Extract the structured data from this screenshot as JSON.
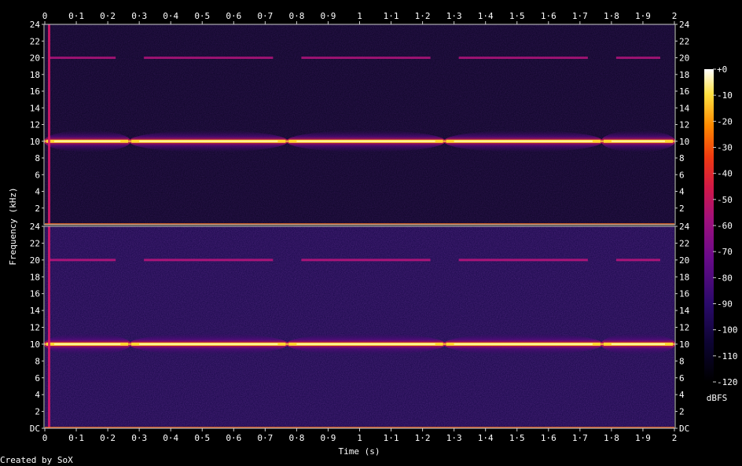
{
  "chart_data": {
    "type": "heatmap",
    "title": "",
    "xlabel": "Time (s)",
    "ylabel": "Frequency (kHz)",
    "xlim": [
      0,
      2
    ],
    "x_ticks": [
      "0",
      "0·1",
      "0·2",
      "0·3",
      "0·4",
      "0·5",
      "0·6",
      "0·7",
      "0·8",
      "0·9",
      "1",
      "1·1",
      "1·2",
      "1·3",
      "1·4",
      "1·5",
      "1·6",
      "1·7",
      "1·8",
      "1·9",
      "2"
    ],
    "y_ticks_top": [
      "24",
      "22",
      "20",
      "18",
      "16",
      "14",
      "12",
      "10",
      "8",
      "6",
      "4",
      "2"
    ],
    "y_ticks_bottom": [
      "24",
      "22",
      "20",
      "18",
      "16",
      "14",
      "12",
      "10",
      "8",
      "6",
      "4",
      "2",
      "DC"
    ],
    "ylim_khz": [
      0,
      24
    ],
    "channels": 2,
    "tone_khz": 10,
    "harmonic_khz": 20,
    "segment_boundaries_s": [
      0.27,
      0.77,
      1.27,
      1.77
    ],
    "colorbar": {
      "label": "dBFS",
      "ticks": [
        "+0",
        "-10",
        "-20",
        "-30",
        "-40",
        "-50",
        "-60",
        "-70",
        "-80",
        "-90",
        "-100",
        "-110",
        "-120"
      ],
      "range": [
        -120,
        0
      ]
    },
    "credit": "Created by SoX"
  }
}
